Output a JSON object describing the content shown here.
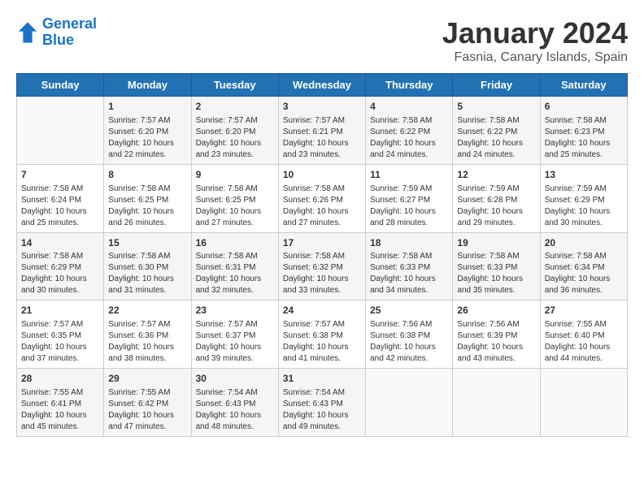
{
  "header": {
    "logo_line1": "General",
    "logo_line2": "Blue",
    "month": "January 2024",
    "location": "Fasnia, Canary Islands, Spain"
  },
  "weekdays": [
    "Sunday",
    "Monday",
    "Tuesday",
    "Wednesday",
    "Thursday",
    "Friday",
    "Saturday"
  ],
  "weeks": [
    [
      {
        "day": "",
        "sunrise": "",
        "sunset": "",
        "daylight": ""
      },
      {
        "day": "1",
        "sunrise": "Sunrise: 7:57 AM",
        "sunset": "Sunset: 6:20 PM",
        "daylight": "Daylight: 10 hours and 22 minutes."
      },
      {
        "day": "2",
        "sunrise": "Sunrise: 7:57 AM",
        "sunset": "Sunset: 6:20 PM",
        "daylight": "Daylight: 10 hours and 23 minutes."
      },
      {
        "day": "3",
        "sunrise": "Sunrise: 7:57 AM",
        "sunset": "Sunset: 6:21 PM",
        "daylight": "Daylight: 10 hours and 23 minutes."
      },
      {
        "day": "4",
        "sunrise": "Sunrise: 7:58 AM",
        "sunset": "Sunset: 6:22 PM",
        "daylight": "Daylight: 10 hours and 24 minutes."
      },
      {
        "day": "5",
        "sunrise": "Sunrise: 7:58 AM",
        "sunset": "Sunset: 6:22 PM",
        "daylight": "Daylight: 10 hours and 24 minutes."
      },
      {
        "day": "6",
        "sunrise": "Sunrise: 7:58 AM",
        "sunset": "Sunset: 6:23 PM",
        "daylight": "Daylight: 10 hours and 25 minutes."
      }
    ],
    [
      {
        "day": "7",
        "sunrise": "Sunrise: 7:58 AM",
        "sunset": "Sunset: 6:24 PM",
        "daylight": "Daylight: 10 hours and 25 minutes."
      },
      {
        "day": "8",
        "sunrise": "Sunrise: 7:58 AM",
        "sunset": "Sunset: 6:25 PM",
        "daylight": "Daylight: 10 hours and 26 minutes."
      },
      {
        "day": "9",
        "sunrise": "Sunrise: 7:58 AM",
        "sunset": "Sunset: 6:25 PM",
        "daylight": "Daylight: 10 hours and 27 minutes."
      },
      {
        "day": "10",
        "sunrise": "Sunrise: 7:58 AM",
        "sunset": "Sunset: 6:26 PM",
        "daylight": "Daylight: 10 hours and 27 minutes."
      },
      {
        "day": "11",
        "sunrise": "Sunrise: 7:59 AM",
        "sunset": "Sunset: 6:27 PM",
        "daylight": "Daylight: 10 hours and 28 minutes."
      },
      {
        "day": "12",
        "sunrise": "Sunrise: 7:59 AM",
        "sunset": "Sunset: 6:28 PM",
        "daylight": "Daylight: 10 hours and 29 minutes."
      },
      {
        "day": "13",
        "sunrise": "Sunrise: 7:59 AM",
        "sunset": "Sunset: 6:29 PM",
        "daylight": "Daylight: 10 hours and 30 minutes."
      }
    ],
    [
      {
        "day": "14",
        "sunrise": "Sunrise: 7:58 AM",
        "sunset": "Sunset: 6:29 PM",
        "daylight": "Daylight: 10 hours and 30 minutes."
      },
      {
        "day": "15",
        "sunrise": "Sunrise: 7:58 AM",
        "sunset": "Sunset: 6:30 PM",
        "daylight": "Daylight: 10 hours and 31 minutes."
      },
      {
        "day": "16",
        "sunrise": "Sunrise: 7:58 AM",
        "sunset": "Sunset: 6:31 PM",
        "daylight": "Daylight: 10 hours and 32 minutes."
      },
      {
        "day": "17",
        "sunrise": "Sunrise: 7:58 AM",
        "sunset": "Sunset: 6:32 PM",
        "daylight": "Daylight: 10 hours and 33 minutes."
      },
      {
        "day": "18",
        "sunrise": "Sunrise: 7:58 AM",
        "sunset": "Sunset: 6:33 PM",
        "daylight": "Daylight: 10 hours and 34 minutes."
      },
      {
        "day": "19",
        "sunrise": "Sunrise: 7:58 AM",
        "sunset": "Sunset: 6:33 PM",
        "daylight": "Daylight: 10 hours and 35 minutes."
      },
      {
        "day": "20",
        "sunrise": "Sunrise: 7:58 AM",
        "sunset": "Sunset: 6:34 PM",
        "daylight": "Daylight: 10 hours and 36 minutes."
      }
    ],
    [
      {
        "day": "21",
        "sunrise": "Sunrise: 7:57 AM",
        "sunset": "Sunset: 6:35 PM",
        "daylight": "Daylight: 10 hours and 37 minutes."
      },
      {
        "day": "22",
        "sunrise": "Sunrise: 7:57 AM",
        "sunset": "Sunset: 6:36 PM",
        "daylight": "Daylight: 10 hours and 38 minutes."
      },
      {
        "day": "23",
        "sunrise": "Sunrise: 7:57 AM",
        "sunset": "Sunset: 6:37 PM",
        "daylight": "Daylight: 10 hours and 39 minutes."
      },
      {
        "day": "24",
        "sunrise": "Sunrise: 7:57 AM",
        "sunset": "Sunset: 6:38 PM",
        "daylight": "Daylight: 10 hours and 41 minutes."
      },
      {
        "day": "25",
        "sunrise": "Sunrise: 7:56 AM",
        "sunset": "Sunset: 6:38 PM",
        "daylight": "Daylight: 10 hours and 42 minutes."
      },
      {
        "day": "26",
        "sunrise": "Sunrise: 7:56 AM",
        "sunset": "Sunset: 6:39 PM",
        "daylight": "Daylight: 10 hours and 43 minutes."
      },
      {
        "day": "27",
        "sunrise": "Sunrise: 7:55 AM",
        "sunset": "Sunset: 6:40 PM",
        "daylight": "Daylight: 10 hours and 44 minutes."
      }
    ],
    [
      {
        "day": "28",
        "sunrise": "Sunrise: 7:55 AM",
        "sunset": "Sunset: 6:41 PM",
        "daylight": "Daylight: 10 hours and 45 minutes."
      },
      {
        "day": "29",
        "sunrise": "Sunrise: 7:55 AM",
        "sunset": "Sunset: 6:42 PM",
        "daylight": "Daylight: 10 hours and 47 minutes."
      },
      {
        "day": "30",
        "sunrise": "Sunrise: 7:54 AM",
        "sunset": "Sunset: 6:43 PM",
        "daylight": "Daylight: 10 hours and 48 minutes."
      },
      {
        "day": "31",
        "sunrise": "Sunrise: 7:54 AM",
        "sunset": "Sunset: 6:43 PM",
        "daylight": "Daylight: 10 hours and 49 minutes."
      },
      {
        "day": "",
        "sunrise": "",
        "sunset": "",
        "daylight": ""
      },
      {
        "day": "",
        "sunrise": "",
        "sunset": "",
        "daylight": ""
      },
      {
        "day": "",
        "sunrise": "",
        "sunset": "",
        "daylight": ""
      }
    ]
  ]
}
